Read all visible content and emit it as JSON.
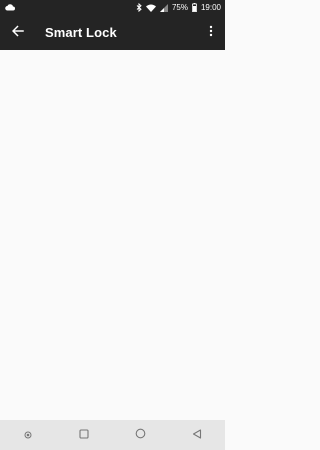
{
  "status_bar": {
    "battery_percent": "75%",
    "time": "19:00",
    "icons": [
      "cloud-icon",
      "bluetooth-icon",
      "wifi-icon",
      "signal-icon",
      "battery-icon"
    ]
  },
  "toolbar": {
    "title": "Smart Lock",
    "back_icon": "arrow-left-icon",
    "menu_icon": "more-vert-icon"
  },
  "nav_bar": {
    "icons": [
      "dot-icon",
      "recents-square-icon",
      "home-circle-icon",
      "back-triangle-icon"
    ]
  },
  "colors": {
    "toolbar_bg": "#242424",
    "content_bg": "#fafafa",
    "nav_bg": "#e6e6e6"
  }
}
